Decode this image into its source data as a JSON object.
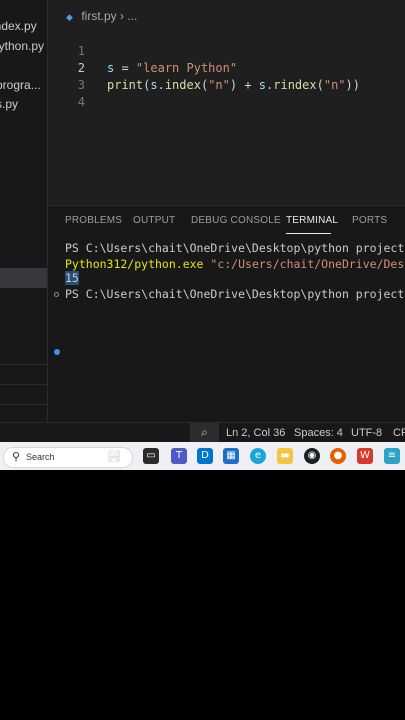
{
  "sidebar": {
    "files": [
      "index.py",
      "python.py",
      "progra...",
      "s.py"
    ]
  },
  "editor": {
    "breadcrumb": {
      "file": "first.py",
      "separator": "›",
      "rest": "..."
    },
    "lines": [
      {
        "number": "1",
        "tokens": [
          [
            "var",
            "s"
          ],
          [
            "op",
            " = "
          ],
          [
            "str",
            "\"learn Python\""
          ]
        ]
      },
      {
        "number": "2",
        "tokens": [
          [
            "fn",
            "print"
          ],
          [
            "op",
            "("
          ],
          [
            "var",
            "s"
          ],
          [
            "op",
            "."
          ],
          [
            "fn",
            "index"
          ],
          [
            "op",
            "("
          ],
          [
            "str",
            "\"n\""
          ],
          [
            "op",
            ") + "
          ],
          [
            "var",
            "s"
          ],
          [
            "op",
            "."
          ],
          [
            "fn",
            "rindex"
          ],
          [
            "op",
            "("
          ],
          [
            "str",
            "\"n\""
          ],
          [
            "op",
            "))"
          ]
        ]
      },
      {
        "number": "3",
        "tokens": []
      },
      {
        "number": "4",
        "tokens": []
      }
    ]
  },
  "panel": {
    "tabs": [
      "PROBLEMS",
      "OUTPUT",
      "DEBUG CONSOLE",
      "TERMINAL",
      "PORTS"
    ],
    "active_tab": "TERMINAL",
    "terminal": {
      "line1": "PS C:\\Users\\chait\\OneDrive\\Desktop\\python projects> & c:",
      "line2_exe": "Python312/python.exe ",
      "line2_path": "\"c:/Users/chait/OneDrive/Desktop/python projects/first.py\"",
      "output": "15",
      "prompt": "PS C:\\Users\\chait\\OneDrive\\Desktop\\python projects> "
    }
  },
  "statusbar": {
    "position": "Ln 2, Col 36",
    "spaces": "Spaces: 4",
    "encoding": "UTF-8",
    "eol": "CRLF"
  },
  "taskbar": {
    "search_placeholder": "Search",
    "icons": [
      "file-explorer-icon",
      "teams-icon",
      "dell-icon",
      "calendar-icon",
      "edge-icon",
      "folder-icon",
      "github-icon",
      "firefox-icon",
      "wps-icon",
      "notepad-icon"
    ]
  },
  "colors": {
    "editor_bg": "#1f1f1f",
    "panel_bg": "#181818",
    "string": "#ce9178",
    "function": "#dcdcaa",
    "variable": "#9cdcfe",
    "terminal_yellow": "#e5e510",
    "accent_blue": "#3794ff"
  }
}
